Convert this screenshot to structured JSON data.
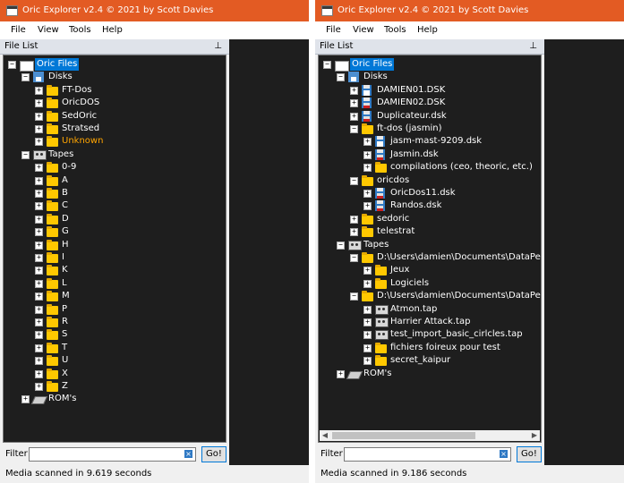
{
  "windows": [
    {
      "title": "Oric Explorer v2.4 © 2021 by Scott Davies",
      "menu": [
        "File",
        "View",
        "Tools",
        "Help"
      ],
      "panel_title": "File List",
      "pin": "⊥",
      "filter_label": "Filter",
      "filter_value": "",
      "clear_glyph": "×",
      "go_label": "Go!",
      "status": "Media scanned in 9.619 seconds",
      "tree": [
        {
          "level": 0,
          "exp": "−",
          "icon": "rootfolder",
          "label": "Oric Files",
          "selected": true
        },
        {
          "level": 1,
          "exp": "−",
          "icon": "disks-icon",
          "label": "Disks"
        },
        {
          "level": 2,
          "exp": "+",
          "icon": "folder",
          "label": "FT-Dos"
        },
        {
          "level": 2,
          "exp": "+",
          "icon": "folder",
          "label": "OricDOS"
        },
        {
          "level": 2,
          "exp": "+",
          "icon": "folder",
          "label": "SedOric"
        },
        {
          "level": 2,
          "exp": "+",
          "icon": "folder",
          "label": "Stratsed"
        },
        {
          "level": 2,
          "exp": "+",
          "icon": "folder",
          "label": "Unknown",
          "orange": true
        },
        {
          "level": 1,
          "exp": "−",
          "icon": "tape",
          "label": "Tapes"
        },
        {
          "level": 2,
          "exp": "+",
          "icon": "folder",
          "label": "0-9"
        },
        {
          "level": 2,
          "exp": "+",
          "icon": "folder",
          "label": "A"
        },
        {
          "level": 2,
          "exp": "+",
          "icon": "folder",
          "label": "B"
        },
        {
          "level": 2,
          "exp": "+",
          "icon": "folder",
          "label": "C"
        },
        {
          "level": 2,
          "exp": "+",
          "icon": "folder",
          "label": "D"
        },
        {
          "level": 2,
          "exp": "+",
          "icon": "folder",
          "label": "G"
        },
        {
          "level": 2,
          "exp": "+",
          "icon": "folder",
          "label": "H"
        },
        {
          "level": 2,
          "exp": "+",
          "icon": "folder",
          "label": "I"
        },
        {
          "level": 2,
          "exp": "+",
          "icon": "folder",
          "label": "K"
        },
        {
          "level": 2,
          "exp": "+",
          "icon": "folder",
          "label": "L"
        },
        {
          "level": 2,
          "exp": "+",
          "icon": "folder",
          "label": "M"
        },
        {
          "level": 2,
          "exp": "+",
          "icon": "folder",
          "label": "P"
        },
        {
          "level": 2,
          "exp": "+",
          "icon": "folder",
          "label": "R"
        },
        {
          "level": 2,
          "exp": "+",
          "icon": "folder",
          "label": "S"
        },
        {
          "level": 2,
          "exp": "+",
          "icon": "folder",
          "label": "T"
        },
        {
          "level": 2,
          "exp": "+",
          "icon": "folder",
          "label": "U"
        },
        {
          "level": 2,
          "exp": "+",
          "icon": "folder",
          "label": "X"
        },
        {
          "level": 2,
          "exp": "+",
          "icon": "folder",
          "label": "Z"
        },
        {
          "level": 1,
          "exp": "+",
          "icon": "rom",
          "label": "ROM's"
        }
      ]
    },
    {
      "title": "Oric Explorer v2.4 © 2021 by Scott Davies",
      "menu": [
        "File",
        "View",
        "Tools",
        "Help"
      ],
      "panel_title": "File List",
      "pin": "⊥",
      "filter_label": "Filter",
      "filter_value": "",
      "clear_glyph": "×",
      "go_label": "Go!",
      "status": "Media scanned in 9.186 seconds",
      "scroll_left": "◀",
      "scroll_right": "▶",
      "tree": [
        {
          "level": 0,
          "exp": "−",
          "icon": "rootfolder",
          "label": "Oric Files",
          "selected": true
        },
        {
          "level": 1,
          "exp": "−",
          "icon": "disks-icon",
          "label": "Disks"
        },
        {
          "level": 2,
          "exp": "+",
          "icon": "disk",
          "label": "DAMIEN01.DSK"
        },
        {
          "level": 2,
          "exp": "+",
          "icon": "disk red",
          "label": "DAMIEN02.DSK"
        },
        {
          "level": 2,
          "exp": "+",
          "icon": "disk red",
          "label": "Duplicateur.dsk"
        },
        {
          "level": 2,
          "exp": "−",
          "icon": "folder",
          "label": "ft-dos (jasmin)"
        },
        {
          "level": 3,
          "exp": "+",
          "icon": "disk",
          "label": "jasm-mast-9209.dsk"
        },
        {
          "level": 3,
          "exp": "+",
          "icon": "disk red",
          "label": "Jasmin.dsk"
        },
        {
          "level": 3,
          "exp": "+",
          "icon": "folder",
          "label": "compilations (ceo, theoric, etc.)"
        },
        {
          "level": 2,
          "exp": "−",
          "icon": "folder",
          "label": "oricdos"
        },
        {
          "level": 3,
          "exp": "+",
          "icon": "disk red",
          "label": "OricDos11.dsk"
        },
        {
          "level": 3,
          "exp": "+",
          "icon": "disk red",
          "label": "Randos.dsk"
        },
        {
          "level": 2,
          "exp": "+",
          "icon": "folder",
          "label": "sedoric"
        },
        {
          "level": 2,
          "exp": "+",
          "icon": "folder",
          "label": "telestrat"
        },
        {
          "level": 1,
          "exp": "−",
          "icon": "tape",
          "label": "Tapes"
        },
        {
          "level": 2,
          "exp": "−",
          "icon": "folder",
          "label": "D:\\Users\\damien\\Documents\\DataPers\\Em"
        },
        {
          "level": 3,
          "exp": "+",
          "icon": "folder",
          "label": "Jeux"
        },
        {
          "level": 3,
          "exp": "+",
          "icon": "folder",
          "label": "Logiciels"
        },
        {
          "level": 2,
          "exp": "−",
          "icon": "folder",
          "label": "D:\\Users\\damien\\Documents\\DataPers\\Em"
        },
        {
          "level": 3,
          "exp": "+",
          "icon": "tape",
          "label": "Atmon.tap"
        },
        {
          "level": 3,
          "exp": "+",
          "icon": "tape",
          "label": "Harrier Attack.tap"
        },
        {
          "level": 3,
          "exp": "+",
          "icon": "tape",
          "label": "test_import_basic_cirlcles.tap"
        },
        {
          "level": 3,
          "exp": "+",
          "icon": "folder",
          "label": "fichiers foireux pour test"
        },
        {
          "level": 3,
          "exp": "+",
          "icon": "folder",
          "label": "secret_kaipur"
        },
        {
          "level": 1,
          "exp": "+",
          "icon": "rom",
          "label": "ROM's"
        }
      ]
    }
  ]
}
